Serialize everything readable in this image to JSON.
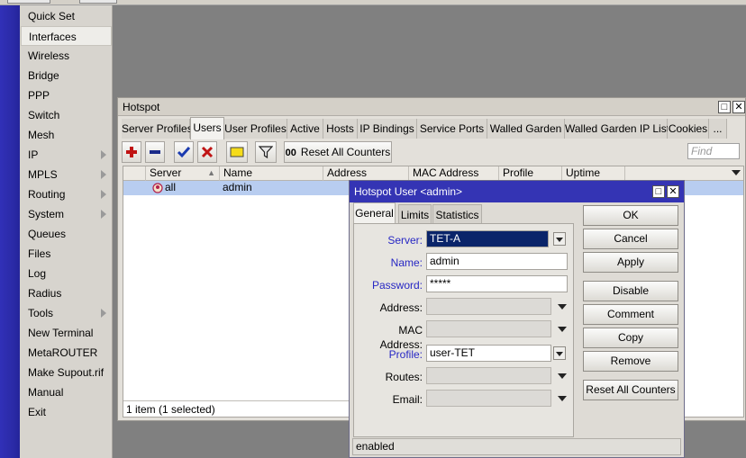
{
  "sidebar": {
    "items": [
      {
        "label": "Quick Set",
        "arrow": false
      },
      {
        "label": "Interfaces",
        "arrow": false
      },
      {
        "label": "Wireless",
        "arrow": false
      },
      {
        "label": "Bridge",
        "arrow": false
      },
      {
        "label": "PPP",
        "arrow": false
      },
      {
        "label": "Switch",
        "arrow": false
      },
      {
        "label": "Mesh",
        "arrow": false
      },
      {
        "label": "IP",
        "arrow": true
      },
      {
        "label": "MPLS",
        "arrow": true
      },
      {
        "label": "Routing",
        "arrow": true
      },
      {
        "label": "System",
        "arrow": true
      },
      {
        "label": "Queues",
        "arrow": false
      },
      {
        "label": "Files",
        "arrow": false
      },
      {
        "label": "Log",
        "arrow": false
      },
      {
        "label": "Radius",
        "arrow": false
      },
      {
        "label": "Tools",
        "arrow": true
      },
      {
        "label": "New Terminal",
        "arrow": false
      },
      {
        "label": "MetaROUTER",
        "arrow": false
      },
      {
        "label": "Make Supout.rif",
        "arrow": false
      },
      {
        "label": "Manual",
        "arrow": false
      },
      {
        "label": "Exit",
        "arrow": false
      }
    ],
    "selected_index": 1
  },
  "hotspot": {
    "title": "Hotspot",
    "tabs": [
      "Server Profiles",
      "Users",
      "User Profiles",
      "Active",
      "Hosts",
      "IP Bindings",
      "Service Ports",
      "Walled Garden",
      "Walled Garden IP List",
      "Cookies",
      "..."
    ],
    "active_tab": "Users",
    "toolbar": {
      "reset_counters_prefix": "00",
      "reset_counters_label": "Reset All Counters",
      "find_placeholder": "Find"
    },
    "columns": [
      "Server",
      "Name",
      "Address",
      "MAC Address",
      "Profile",
      "Uptime"
    ],
    "rows": [
      {
        "server": "all",
        "name": "admin",
        "address": "",
        "mac": "",
        "profile": "",
        "uptime": ""
      }
    ],
    "status": "1 item (1 selected)"
  },
  "dialog": {
    "title": "Hotspot User <admin>",
    "tabs": [
      "General",
      "Limits",
      "Statistics"
    ],
    "active_tab": "General",
    "fields": {
      "server": {
        "label": "Server:",
        "value": "TET-A"
      },
      "name": {
        "label": "Name:",
        "value": "admin"
      },
      "password": {
        "label": "Password:",
        "value": "*****"
      },
      "address": {
        "label": "Address:",
        "value": ""
      },
      "mac": {
        "label": "MAC Address:",
        "value": ""
      },
      "profile": {
        "label": "Profile:",
        "value": "user-TET"
      },
      "routes": {
        "label": "Routes:",
        "value": ""
      },
      "email": {
        "label": "Email:",
        "value": ""
      }
    },
    "buttons": {
      "ok": "OK",
      "cancel": "Cancel",
      "apply": "Apply",
      "disable": "Disable",
      "comment": "Comment",
      "copy": "Copy",
      "remove": "Remove",
      "reset": "Reset All Counters"
    },
    "status": "enabled"
  },
  "colors": {
    "accent_bar": "#2a2aa5",
    "dialog_title": "#3434b4",
    "selection": "#0a246a",
    "field_label_blue": "#2727c4"
  }
}
